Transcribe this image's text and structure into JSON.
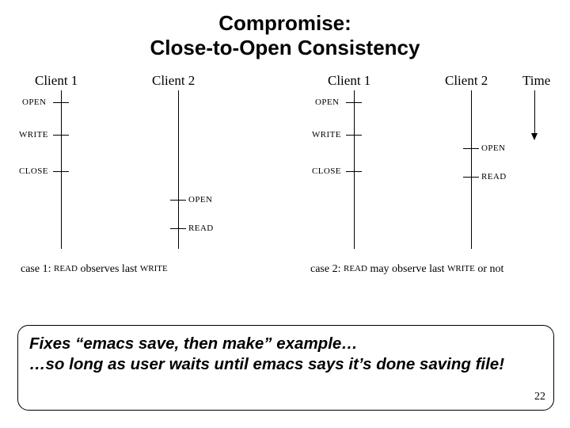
{
  "title_line1": "Compromise:",
  "title_line2": "Close-to-Open Consistency",
  "labels": {
    "client1_a": "Client 1",
    "client2_a": "Client 2",
    "client1_b": "Client 1",
    "client2_b": "Client 2",
    "time": "Time"
  },
  "ops": {
    "open": "OPEN",
    "write": "WRITE",
    "close": "CLOSE",
    "read": "READ"
  },
  "captions": {
    "case1_pre": "case 1: ",
    "case1_read": "READ",
    "case1_mid": " observes last ",
    "case1_write": "WRITE",
    "case2_pre": "case 2: ",
    "case2_read": "READ",
    "case2_mid": " may observe last ",
    "case2_write": "WRITE",
    "case2_suf": " or not"
  },
  "note_line1": "Fixes “emacs save, then make” example…",
  "note_line2": "…so long as user waits until emacs says it’s done saving file!",
  "page_number": "22"
}
